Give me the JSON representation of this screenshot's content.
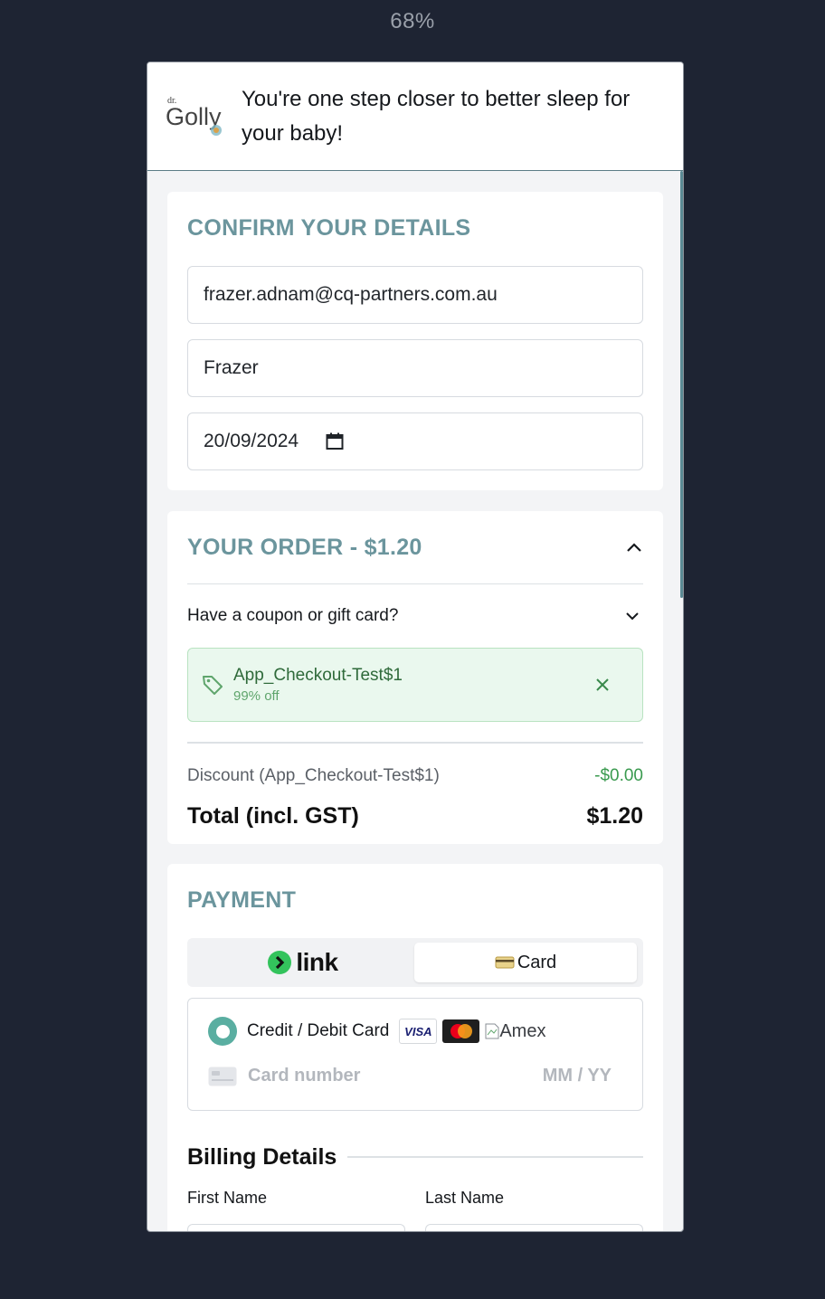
{
  "zoom_level": "68%",
  "header": {
    "logo_top": "dr.",
    "logo_main": "Golly",
    "tagline": "You're one step closer to better sleep for your baby!"
  },
  "details": {
    "title": "CONFIRM YOUR DETAILS",
    "email": "frazer.adnam@cq-partners.com.au",
    "first_name": "Frazer",
    "date": "20/09/2024"
  },
  "order": {
    "title": "YOUR ORDER - $1.20",
    "coupon_prompt": "Have a coupon or gift card?",
    "coupon_code": "App_Checkout-Test$1",
    "coupon_discount": "99% off",
    "discount_label": "Discount (App_Checkout-Test$1)",
    "discount_value": "-$0.00",
    "total_label": "Total (incl. GST)",
    "total_value": "$1.20"
  },
  "payment": {
    "title": "PAYMENT",
    "link_label": "link",
    "card_tab_label": "Card",
    "method_label": "Credit / Debit Card",
    "brands": {
      "visa": "VISA",
      "amex_alt": "Amex"
    },
    "card_number_placeholder": "Card number",
    "expiry_placeholder": "MM / YY"
  },
  "billing": {
    "title": "Billing Details",
    "first_name_label": "First Name",
    "last_name_label": "Last Name"
  },
  "colors": {
    "accent": "#6b959d",
    "radio": "#5aaea1",
    "link_green": "#33c35c",
    "discount_green": "#3a9a4f"
  }
}
